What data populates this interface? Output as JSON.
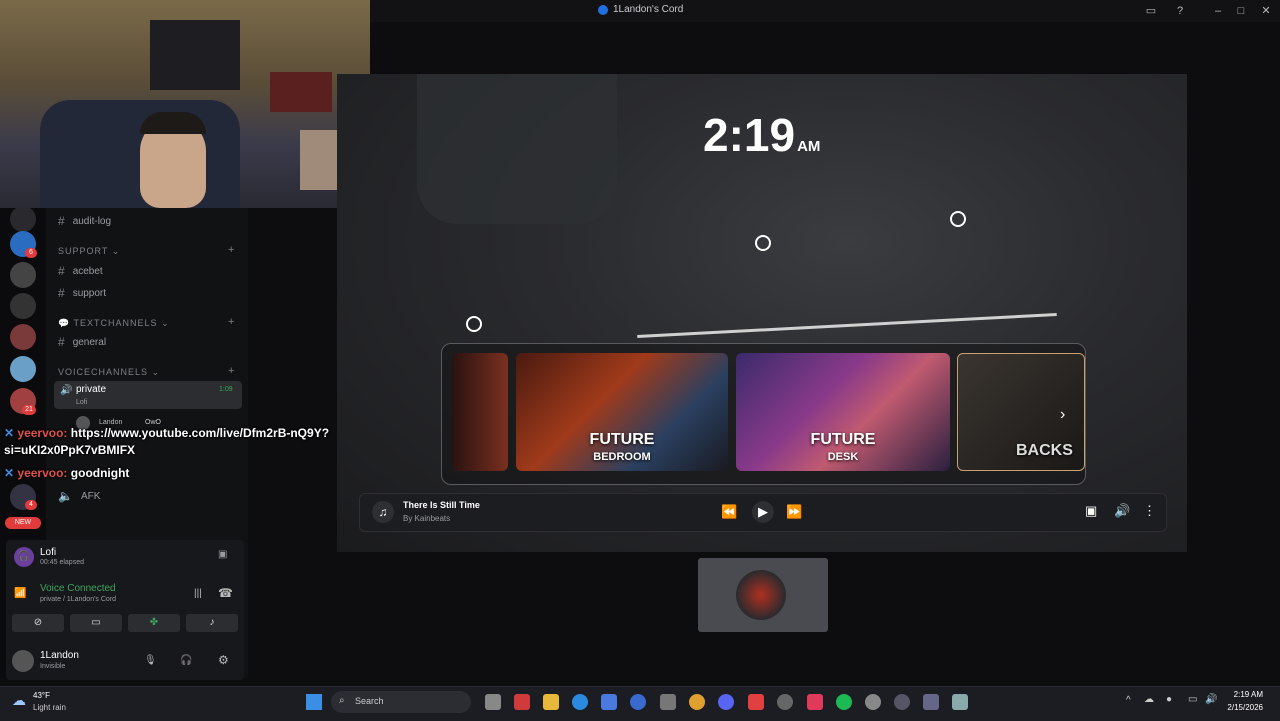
{
  "window": {
    "title": "1Landon's Cord"
  },
  "sidebar": {
    "channels_top": [
      {
        "label": "audit-log"
      }
    ],
    "categories": [
      {
        "label": "SUPPORT",
        "channels": [
          "acebet",
          "support"
        ]
      },
      {
        "label": "TEXTCHANNELS",
        "channels": [
          "general"
        ]
      },
      {
        "label": "VOICECHANNELS",
        "channels": [
          "private",
          "AFK"
        ]
      }
    ],
    "active_voice": {
      "name": "private",
      "activity": "Lofi",
      "time": "1:09",
      "member": "Landon",
      "member_tag": "OwO"
    },
    "server_badges": [
      "6",
      "21",
      "4"
    ],
    "new_badge": "NEW"
  },
  "chat_overlay": {
    "line1_user": "yeervoo:",
    "line1_text": "https://www.youtube.com/live/Dfm2rB-nQ9Y?",
    "line2_text": "si=uKI2x0PpK7vBMIFX",
    "line3_user": "yeervoo:",
    "line3_text": "goodnight"
  },
  "activity_panel": {
    "title": "Lofi",
    "elapsed": "00:45 elapsed"
  },
  "voice_status": {
    "label": "Voice Connected",
    "location": "private / 1Landon's Cord"
  },
  "user": {
    "name": "1Landon",
    "status": "Invisible"
  },
  "clock": {
    "time": "2:19",
    "ampm": "AM"
  },
  "carousel": {
    "cards": [
      {
        "line1": "FUTURE",
        "line2": "BEDROOM"
      },
      {
        "line1": "FUTURE",
        "line2": "DESK"
      },
      {
        "line1": "BACKS",
        "line2": ""
      }
    ]
  },
  "player": {
    "track": "There Is Still Time",
    "artist": "By Kainbeats"
  },
  "taskbar": {
    "weather_temp": "43°F",
    "weather_desc": "Light rain",
    "search_label": "Search",
    "time": "2:19 AM",
    "date": "2/15/2026"
  },
  "colors": {
    "accent_green": "#3ba55d",
    "brand_blue": "#1f6fe0",
    "bg": "#0d0d0f"
  }
}
